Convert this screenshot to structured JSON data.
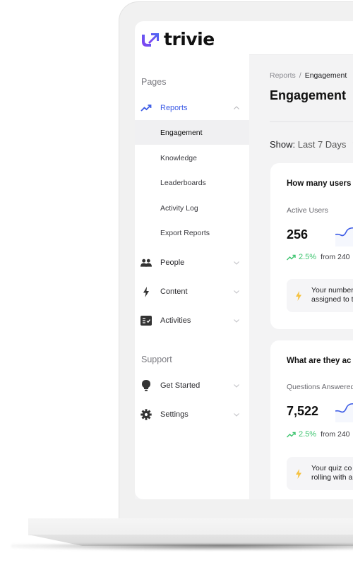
{
  "brand": {
    "name": "trivie",
    "accent_from": "#7b3ff2",
    "accent_to": "#4c6ef5"
  },
  "sidebar": {
    "pages_label": "Pages",
    "support_label": "Support",
    "reports": {
      "label": "Reports",
      "icon": "trending-up-icon",
      "expanded": true,
      "children": [
        {
          "label": "Engagement",
          "selected": true
        },
        {
          "label": "Knowledge"
        },
        {
          "label": "Leaderboards"
        },
        {
          "label": "Activity Log"
        },
        {
          "label": "Export Reports"
        }
      ]
    },
    "items": [
      {
        "label": "People",
        "icon": "people-icon"
      },
      {
        "label": "Content",
        "icon": "bolt-icon"
      },
      {
        "label": "Activities",
        "icon": "checklist-icon"
      }
    ],
    "support_items": [
      {
        "label": "Get Started",
        "icon": "lightbulb-icon"
      },
      {
        "label": "Settings",
        "icon": "gear-icon"
      }
    ]
  },
  "main": {
    "breadcrumb": {
      "parent": "Reports",
      "separator": "/",
      "current": "Engagement"
    },
    "title": "Engagement",
    "show": {
      "label": "Show:",
      "value": "Last 7 Days"
    },
    "cards": [
      {
        "title": "How many users",
        "metric_label": "Active Users",
        "metric_value": "256",
        "delta_pct": "2.5%",
        "delta_from": "from 240",
        "tip_line1": "Your number",
        "tip_line2": "assigned to t"
      },
      {
        "title": "What are they ac",
        "metric_label": "Questions Answered",
        "metric_value": "7,522",
        "delta_pct": "2.5%",
        "delta_from": "from 240",
        "tip_line1": "Your quiz co",
        "tip_line2": "rolling with a"
      }
    ]
  },
  "colors": {
    "active": "#3d5ce6",
    "positive": "#3cc46e",
    "tip_icon": "#f5c242"
  }
}
